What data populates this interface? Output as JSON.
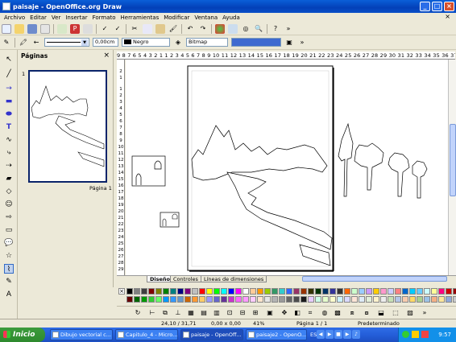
{
  "window": {
    "title": "paisaje - OpenOffice.org Draw"
  },
  "menu": {
    "items": [
      "Archivo",
      "Editar",
      "Ver",
      "Insertar",
      "Formato",
      "Herramientas",
      "Modificar",
      "Ventana",
      "Ayuda"
    ],
    "close_doc": "×"
  },
  "line_toolbar": {
    "line_width": "0,00cm",
    "color_name": "Negro",
    "fill_name": "Bitmap"
  },
  "pages_panel": {
    "title": "Páginas",
    "close": "×",
    "page_number": "1",
    "page_label": "Página 1"
  },
  "ruler": {
    "horizontal": "9 8 7 6 5 4 3 2 1   1 2 3 4 5 6 7 8 9 10 11 12 13 14 15 16 17 18 19 20 21 22 23 24 25 26 27 28 29 30 31 32 33 34 35 36 37",
    "vertical": [
      "2",
      "1",
      "1",
      "2",
      "3",
      "4",
      "5",
      "6",
      "7",
      "8",
      "9",
      "10",
      "11",
      "12",
      "13",
      "14",
      "15",
      "16",
      "17",
      "18",
      "19",
      "20",
      "21",
      "22",
      "23",
      "24",
      "25",
      "26",
      "27",
      "28",
      "29",
      "30"
    ]
  },
  "tabs": [
    "Diseño",
    "Controles",
    "Líneas de dimensiones"
  ],
  "palette": {
    "colors": [
      "#000000",
      "#808080",
      "#404040",
      "#800000",
      "#808000",
      "#008000",
      "#008080",
      "#000080",
      "#800080",
      "#c0c0c0",
      "#ff0000",
      "#ffff00",
      "#00ff00",
      "#00ffff",
      "#0000ff",
      "#ff00ff",
      "#ffffff",
      "#ffcc99",
      "#ff9900",
      "#99cc00",
      "#339966",
      "#33cccc",
      "#3366ff",
      "#993366",
      "#993300",
      "#333300",
      "#003300",
      "#003366",
      "#333399",
      "#333333",
      "#ff6600",
      "#ccffcc",
      "#99ccff",
      "#cc99ff",
      "#ffcc00",
      "#ff99cc",
      "#ccccff",
      "#ff8080",
      "#0066cc",
      "#00ccff",
      "#66ccff",
      "#ccffff",
      "#ffff99",
      "#ff0080",
      "#cc0000",
      "#990000",
      "#660000",
      "#006600",
      "#009900",
      "#33cc33",
      "#66ff66",
      "#0099ff",
      "#3399ff",
      "#6699cc",
      "#cc6600",
      "#ff9933",
      "#ffcc66",
      "#9999ff",
      "#6666cc",
      "#663399",
      "#cc33cc",
      "#ff66ff",
      "#ff99ff",
      "#ffccff",
      "#ffe5cc",
      "#e6e6e6",
      "#b3b3b3",
      "#999999",
      "#666666",
      "#4d4d4d",
      "#1a1a1a",
      "#e6ccff",
      "#ccffe5",
      "#e5ffcc",
      "#ffffcc",
      "#ccf2ff",
      "#d9d9ff",
      "#fce4d6",
      "#ddebf7",
      "#e2efda",
      "#fff2cc",
      "#ededed",
      "#c6e0b4",
      "#b4c6e7",
      "#f8cbad",
      "#ffd966",
      "#a9d08e",
      "#9bc2e6",
      "#f4b084",
      "#ffe699",
      "#8ea9db",
      "#c9c9c9"
    ]
  },
  "status": {
    "position": "24,10 / 31,71",
    "size": "0,00 x 0,00",
    "zoom": "41%",
    "page": "Página 1 / 1",
    "layout": "Predeterminado"
  },
  "taskbar": {
    "start": "Inicio",
    "tasks": [
      "Dibujo vectorial c...",
      "Capitulo_4 - Micro...",
      "paisaje - OpenOff...",
      "paisaje2 - OpenO..."
    ],
    "language": "ES",
    "clock": "9:57"
  }
}
